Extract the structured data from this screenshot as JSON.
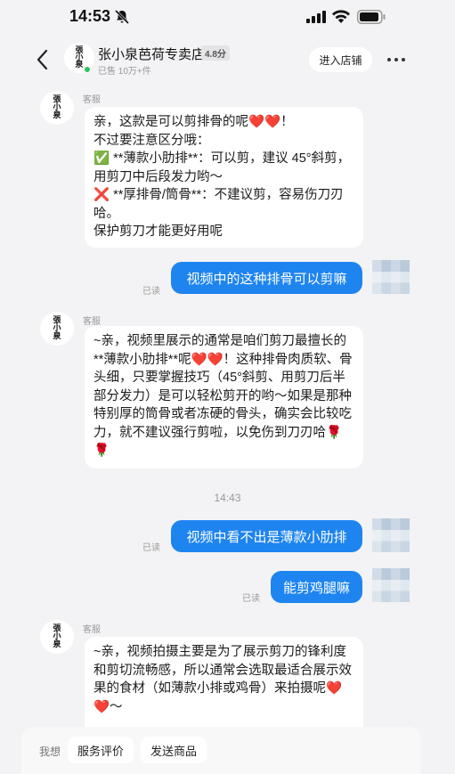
{
  "status_bar": {
    "time": "14:53"
  },
  "header": {
    "shop_name": "张小泉芭荷专卖店",
    "score": "4.8分",
    "sold": "已售 10万+件",
    "enter_shop": "进入店铺",
    "logo_text": "張小泉"
  },
  "chat": {
    "agent_label": "客服",
    "read_label": "已读",
    "messages": [
      {
        "from": "agent",
        "text": "亲，这款是可以剪排骨的呢❤️❤️！\n不过要注意区分哦：\n✅ **薄款小肋排**：可以剪，建议 45°斜剪，用剪刀中后段发力哟～\n❌ **厚排骨/筒骨**：不建议剪，容易伤刀刃哈。\n保护剪刀才能更好用呢"
      },
      {
        "from": "user",
        "text": "视频中的这种排骨可以剪嘛"
      },
      {
        "from": "agent",
        "text": "~亲，视频里展示的通常是咱们剪刀最擅长的**薄款小肋排**呢❤️❤️！这种排骨肉质软、骨头细，只要掌握技巧（45°斜剪、用剪刀后半部分发力）是可以轻松剪开的哟～如果是那种特别厚的筒骨或者冻硬的骨头，确实会比较吃力，就不建议强行剪啦，以免伤到刀刃哈🌹🌹"
      },
      {
        "from": "time",
        "text": "14:43"
      },
      {
        "from": "user",
        "text": "视频中看不出是薄款小肋排"
      },
      {
        "from": "user",
        "text": "能剪鸡腿嘛"
      },
      {
        "from": "agent",
        "text": "~亲，视频拍摄主要是为了展示剪刀的锋利度和剪切流畅感，所以通常会选取最适合展示效果的食材（如薄款小排或鸡骨）来拍摄呢❤️❤️～"
      }
    ]
  },
  "bottom_bar": {
    "hint": "我想",
    "buttons": [
      "服务评价",
      "发送商品"
    ]
  }
}
